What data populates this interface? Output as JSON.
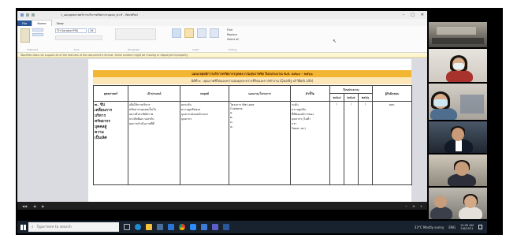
{
  "window": {
    "title": "ร_แผนยุทธศาสตร์การบริหารทรัพยากรบุคคล_ท.rtf - WordPad",
    "controls": {
      "minimize": "–",
      "maximize": "□",
      "close": "✕"
    }
  },
  "ribbon": {
    "tabs": [
      "File",
      "Home",
      "View"
    ],
    "groups": {
      "clipboard": "Clipboard",
      "font": "Font",
      "paragraph": "Paragraph",
      "insert": "Insert",
      "editing": "Editing"
    },
    "font_name": "TH SarabunPSK",
    "font_size": "16",
    "editing_items": [
      "Find",
      "Replace",
      "Select all"
    ]
  },
  "infobar": {
    "text": "WordPad does not support all of the features of this document's format. Some content might be missing or displayed improperly."
  },
  "document": {
    "banner": "แผนกลยุทธ์การบริหารทรัพยากรบุคคล กรมสุขภาพจิต ปีงบประมาณ พ.ศ. ๒๕๖๔ – ๒๕๖๖",
    "subtitle": "มิติที่ ๓ : คุณภาพชีวิตและความสมดุลระหว่างชีวิตและการทำงาน (Quality of Work Life)",
    "headers": {
      "strategy": "ยุทธศาสตร์",
      "objective": "เป้าประสงค์",
      "tactic": "กลยุทธ์",
      "plan": "แผนงาน/โครงการ",
      "indicator": "ตัวชี้วัด",
      "budget": "ปีงบประมาณ",
      "budget_years": [
        "๒๕๖๔",
        "๒๕๖๕",
        "๒๕๖๖"
      ],
      "owner": "ผู้รับผิดชอบ"
    },
    "row": {
      "strategy": [
        "๓. ขับ",
        "เคลื่อนการ",
        "บริหาร",
        "ทรัพยากร",
        "บุคคลสู่",
        "ความ",
        "เป็นเลิศ"
      ],
      "objective": [
        "เพื่อให้การบริหาร",
        "ทรัพยากรบุคคลเป็นไป",
        "อย่างมีประสิทธิภาพ",
        "ประสิทธิผล กอปรกับ",
        "ผลการดำเนินงานที่ดี"
      ],
      "tactic": [
        "ยกระดับ",
        "ความผูกพันของ",
        "บุคลากรต่อองค์กรและ",
        "บุคลากร"
      ],
      "plan": [
        "โครงการ We Love",
        "Customs",
        "๑.",
        "๒.",
        "๓.",
        "๔."
      ],
      "indicator": [
        "ระดับ",
        "ความผูกพัน",
        "ที่มีต่อองค์การของ",
        "บุคลากร (ไม่ต่ำ",
        "กว่า",
        "ร้อยละ ๘๐)"
      ],
      "budget_marks": [
        "/",
        "/",
        "/"
      ],
      "owner": "สลก."
    }
  },
  "statusbar": {
    "left": [
      "◀◀",
      "◀",
      "▶"
    ],
    "right": [
      "−",
      "⊕",
      "+"
    ]
  },
  "taskbar": {
    "search_placeholder": "Type here to search",
    "weather": "33°C  Mostly sunny",
    "lang": "ENG",
    "time": "10:09 AM",
    "date": "2/6/2021"
  }
}
